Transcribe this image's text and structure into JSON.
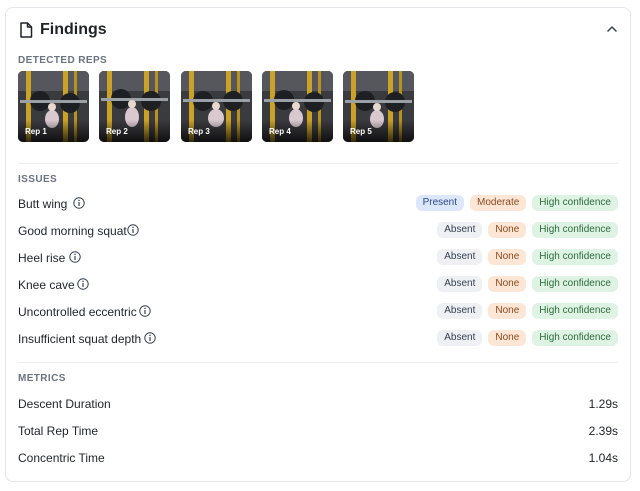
{
  "header": {
    "title": "Findings"
  },
  "sections": {
    "reps_label": "DETECTED REPS",
    "issues_label": "ISSUES",
    "metrics_label": "METRICS"
  },
  "reps": [
    {
      "label": "Rep 1"
    },
    {
      "label": "Rep 2"
    },
    {
      "label": "Rep 3"
    },
    {
      "label": "Rep 4"
    },
    {
      "label": "Rep 5"
    }
  ],
  "issues": [
    {
      "name": "Butt wing",
      "status": "Present",
      "severity": "Moderate",
      "confidence": "High confidence"
    },
    {
      "name": "Good morning squat",
      "status": "Absent",
      "severity": "None",
      "confidence": "High confidence"
    },
    {
      "name": "Heel rise",
      "status": "Absent",
      "severity": "None",
      "confidence": "High confidence"
    },
    {
      "name": "Knee cave",
      "status": "Absent",
      "severity": "None",
      "confidence": "High confidence"
    },
    {
      "name": "Uncontrolled eccentric",
      "status": "Absent",
      "severity": "None",
      "confidence": "High confidence"
    },
    {
      "name": "Insufficient squat depth",
      "status": "Absent",
      "severity": "None",
      "confidence": "High confidence"
    }
  ],
  "metrics": [
    {
      "name": "Descent Duration",
      "value": "1.29s"
    },
    {
      "name": "Total Rep Time",
      "value": "2.39s"
    },
    {
      "name": "Concentric Time",
      "value": "1.04s"
    }
  ],
  "colors": {
    "present_bg": "#dde7fb",
    "moderate_bg": "#fde6d5",
    "absent_bg": "#eef0f3",
    "high_confidence_bg": "#dff3e4"
  }
}
